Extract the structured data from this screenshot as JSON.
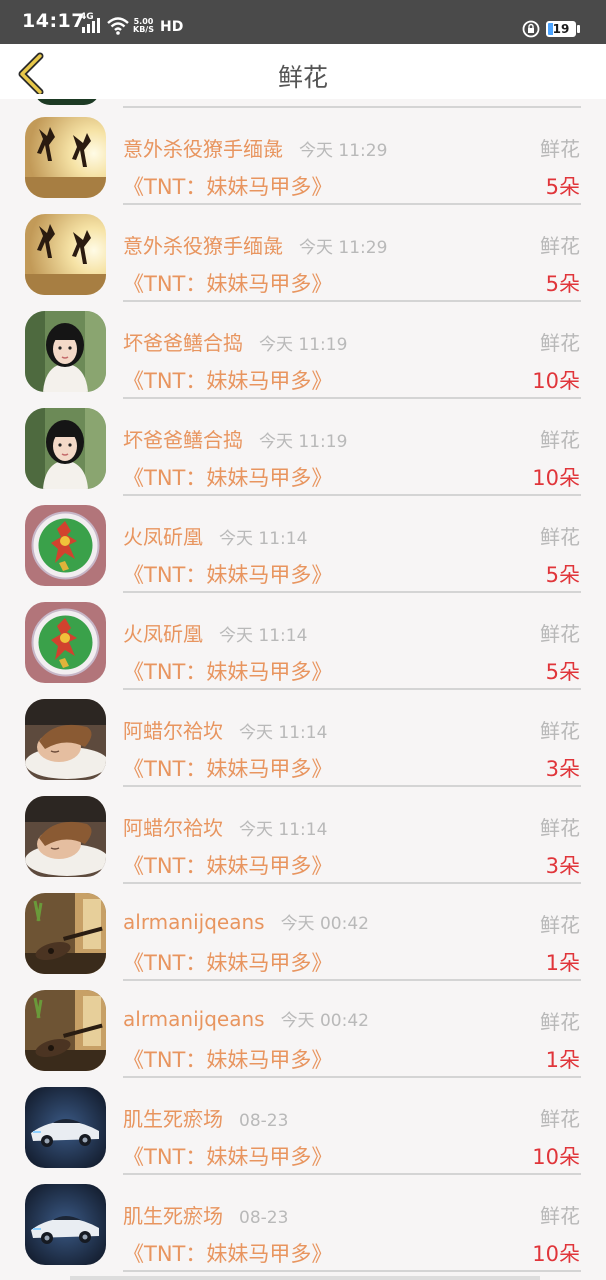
{
  "status_bar": {
    "time": "14:17",
    "network": "4G",
    "speed_top": "5.00",
    "speed_bottom": "KB/S",
    "hd": "HD",
    "battery": "19"
  },
  "header": {
    "title": "鲜花"
  },
  "rows": [
    {
      "name": "意外杀役獠手缅彘",
      "time": "今天 11:29",
      "type": "鲜花",
      "book": "《TNT：妹妹马甲多》",
      "count": "5朵",
      "avatar": "jumping-silhouettes"
    },
    {
      "name": "意外杀役獠手缅彘",
      "time": "今天 11:29",
      "type": "鲜花",
      "book": "《TNT：妹妹马甲多》",
      "count": "5朵",
      "avatar": "jumping-silhouettes"
    },
    {
      "name": "坏爸爸鳝合捣",
      "time": "今天 11:19",
      "type": "鲜花",
      "book": "《TNT：妹妹马甲多》",
      "count": "10朵",
      "avatar": "girl-portrait"
    },
    {
      "name": "坏爸爸鳝合捣",
      "time": "今天 11:19",
      "type": "鲜花",
      "book": "《TNT：妹妹马甲多》",
      "count": "10朵",
      "avatar": "girl-portrait"
    },
    {
      "name": "火凤斫凰",
      "time": "今天 11:14",
      "type": "鲜花",
      "book": "《TNT：妹妹马甲多》",
      "count": "5朵",
      "avatar": "flower-emblem"
    },
    {
      "name": "火凤斫凰",
      "time": "今天 11:14",
      "type": "鲜花",
      "book": "《TNT：妹妹马甲多》",
      "count": "5朵",
      "avatar": "flower-emblem"
    },
    {
      "name": "阿蜡尔祫坎",
      "time": "今天 11:14",
      "type": "鲜花",
      "book": "《TNT：妹妹马甲多》",
      "count": "3朵",
      "avatar": "sleeping-child"
    },
    {
      "name": "阿蜡尔祫坎",
      "time": "今天 11:14",
      "type": "鲜花",
      "book": "《TNT：妹妹马甲多》",
      "count": "3朵",
      "avatar": "sleeping-child"
    },
    {
      "name": "alrmanijqeans",
      "time": "今天 00:42",
      "type": "鲜花",
      "book": "《TNT：妹妹马甲多》",
      "count": "1朵",
      "avatar": "guitar"
    },
    {
      "name": "alrmanijqeans",
      "time": "今天 00:42",
      "type": "鲜花",
      "book": "《TNT：妹妹马甲多》",
      "count": "1朵",
      "avatar": "guitar"
    },
    {
      "name": "肌生死瘀场",
      "time": "08-23",
      "type": "鲜花",
      "book": "《TNT：妹妹马甲多》",
      "count": "10朵",
      "avatar": "sports-car"
    },
    {
      "name": "肌生死瘀场",
      "time": "08-23",
      "type": "鲜花",
      "book": "《TNT：妹妹马甲多》",
      "count": "10朵",
      "avatar": "sports-car"
    }
  ]
}
